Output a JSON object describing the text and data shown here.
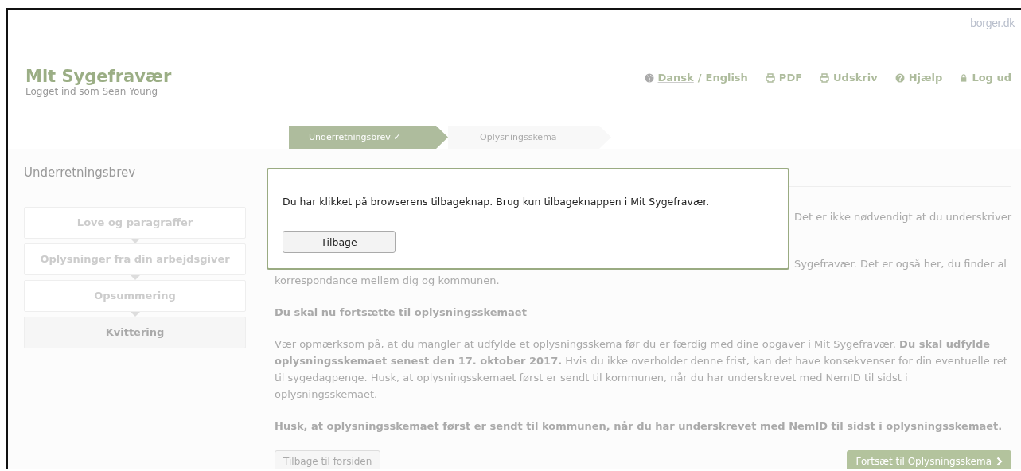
{
  "top_bar": {
    "brand": "borger.dk"
  },
  "header": {
    "title": "Mit Sygefravær",
    "subtitle": "Logget ind som Sean Young",
    "languages": [
      {
        "label": "Dansk",
        "selected": true
      },
      {
        "label": "English",
        "selected": false
      }
    ],
    "language_separator": "/",
    "links": [
      {
        "kind": "pdf",
        "label": "PDF"
      },
      {
        "kind": "print",
        "label": "Udskriv"
      },
      {
        "kind": "help",
        "label": "Hjælp"
      },
      {
        "kind": "logout",
        "label": "Log ud"
      }
    ]
  },
  "steps": [
    {
      "label": "Underretningsbrev ✓",
      "selected": true
    },
    {
      "label": "Oplysningsskema",
      "selected": false
    }
  ],
  "sidebar": {
    "title": "Underretningsbrev",
    "items": [
      {
        "label": "Love og paragraffer",
        "selected": false
      },
      {
        "label": "Oplysninger fra din arbejdsgiver",
        "selected": false
      },
      {
        "label": "Opsummering",
        "selected": false
      },
      {
        "label": "Kvittering",
        "selected": true
      }
    ]
  },
  "content": {
    "fragment_1": "Det er ikke nødvendigt at du underskriver",
    "fragment_2": "Sygefravær. Det er også her, du finder al",
    "line_3": "korrespondance mellem dig og kommunen.",
    "heading": "Du skal nu fortsætte til oplysningsskemaet",
    "paragraph": "Vær opmærksom på, at du mangler at udfylde et oplysningsskema før du er færdig med dine opgaver i Mit Sygefravær. **Du skal udfylde oplysningsskemaet senest den 17. oktober 2017.** Hvis du ikke overholder denne frist, kan det have konsekvenser for din eventuelle ret til sygedagpenge. Husk, at oplysningsskemaet først er sendt til kommunen, når du har underskrevet med NemID til sidst i oplysningsskemaet.",
    "notice": "Husk, at oplysningsskemaet først er sendt til kommunen, når du har underskrevet med NemID til sidst i oplysningsskemaet.",
    "back_button": "Tilbage til forsiden",
    "next_button": "Fortsæt til Oplysningsskema"
  },
  "dialog": {
    "message": "Du har klikket på browserens tilbageknap. Brug kun tilbageknappen i Mit Sygefravær.",
    "button": "Tilbage"
  }
}
